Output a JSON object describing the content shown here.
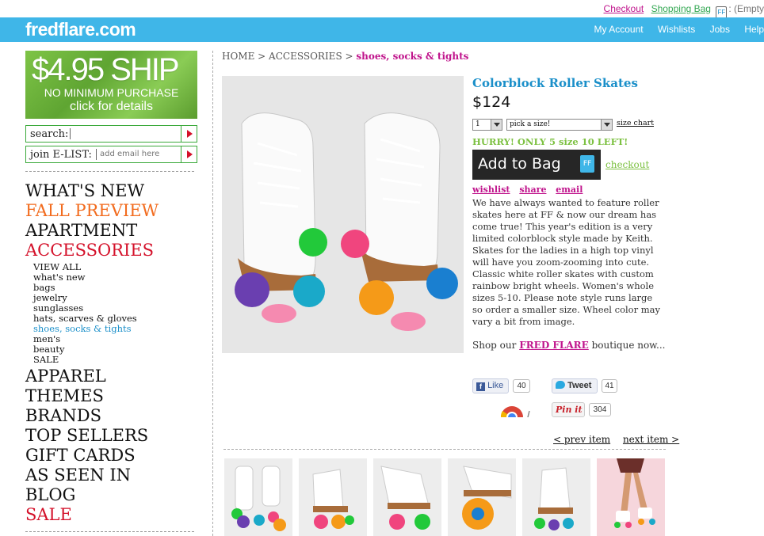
{
  "top_links": {
    "checkout": "Checkout",
    "shopping_bag": "Shopping Bag",
    "bag_icon": "FF",
    "empty": ": (Empty"
  },
  "header": {
    "logo": "fredflare.com",
    "nav": [
      "My Account",
      "Wishlists",
      "Jobs",
      "Help"
    ],
    "accent_color": "#3fb6e8"
  },
  "promo": {
    "line1": "$4.95 SHIP",
    "line2": "NO MINIMUM PURCHASE",
    "line3": "click for details"
  },
  "search": {
    "label": "search:",
    "value": ""
  },
  "elist": {
    "label": "join E-LIST:",
    "placeholder": "add email here"
  },
  "categories": {
    "whats_new": "WHAT'S NEW",
    "fall_preview": "FALL PREVIEW",
    "apartment": "APARTMENT",
    "accessories": "ACCESSORIES",
    "accessories_sub": [
      "VIEW ALL",
      "what's new",
      "bags",
      "jewelry",
      "sunglasses",
      "hats, scarves & gloves",
      "shoes, socks & tights",
      "men's",
      "beauty",
      "SALE"
    ],
    "rest": [
      "APPAREL",
      "THEMES",
      "BRANDS",
      "TOP SELLERS",
      "GIFT CARDS",
      "AS SEEN IN",
      "BLOG",
      "SALE"
    ]
  },
  "breadcrumb": {
    "home": "HOME",
    "sep1": " > ",
    "accessories": "ACCESSORIES",
    "sep2": " > ",
    "current": "shoes, socks & tights"
  },
  "product": {
    "title": "Colorblock Roller Skates",
    "price": "$124",
    "qty": "1",
    "size_placeholder": "pick a size!",
    "size_chart": "size chart",
    "stock_note": "HURRY! ONLY 5 size 10 LEFT!",
    "add_to_bag": "Add to Bag",
    "ff_badge": "FF",
    "checkout": "checkout",
    "wishlist": "wishlist",
    "share": "share",
    "email": "email",
    "description": "We have always wanted to feature roller skates here at FF & now our dream has come true! This year's edition is a very limited colorblock style made by Keith. Skates for the ladies in a high top vinyl will have you zoom-zooming into cute. Classic white roller skates with custom rainbow bright wheels. Women's whole sizes 5-10. Please note style runs large so order a smaller size. Wheel color may vary a bit from image.",
    "shop_prefix": "Shop our ",
    "shop_link": "FRED FLARE",
    "shop_suffix": " boutique now..."
  },
  "social": {
    "like": "Like",
    "like_count": "40",
    "tweet": "Tweet",
    "tweet_count": "41",
    "pin": "Pin it",
    "pin_count": "304"
  },
  "pager": {
    "prev": "< prev item",
    "next": "next item >"
  },
  "wheel_colors": {
    "green": "#22c93a",
    "pink": "#f0457e",
    "purple": "#6a3fb0",
    "teal": "#1aa9c9",
    "orange": "#f59a18"
  }
}
